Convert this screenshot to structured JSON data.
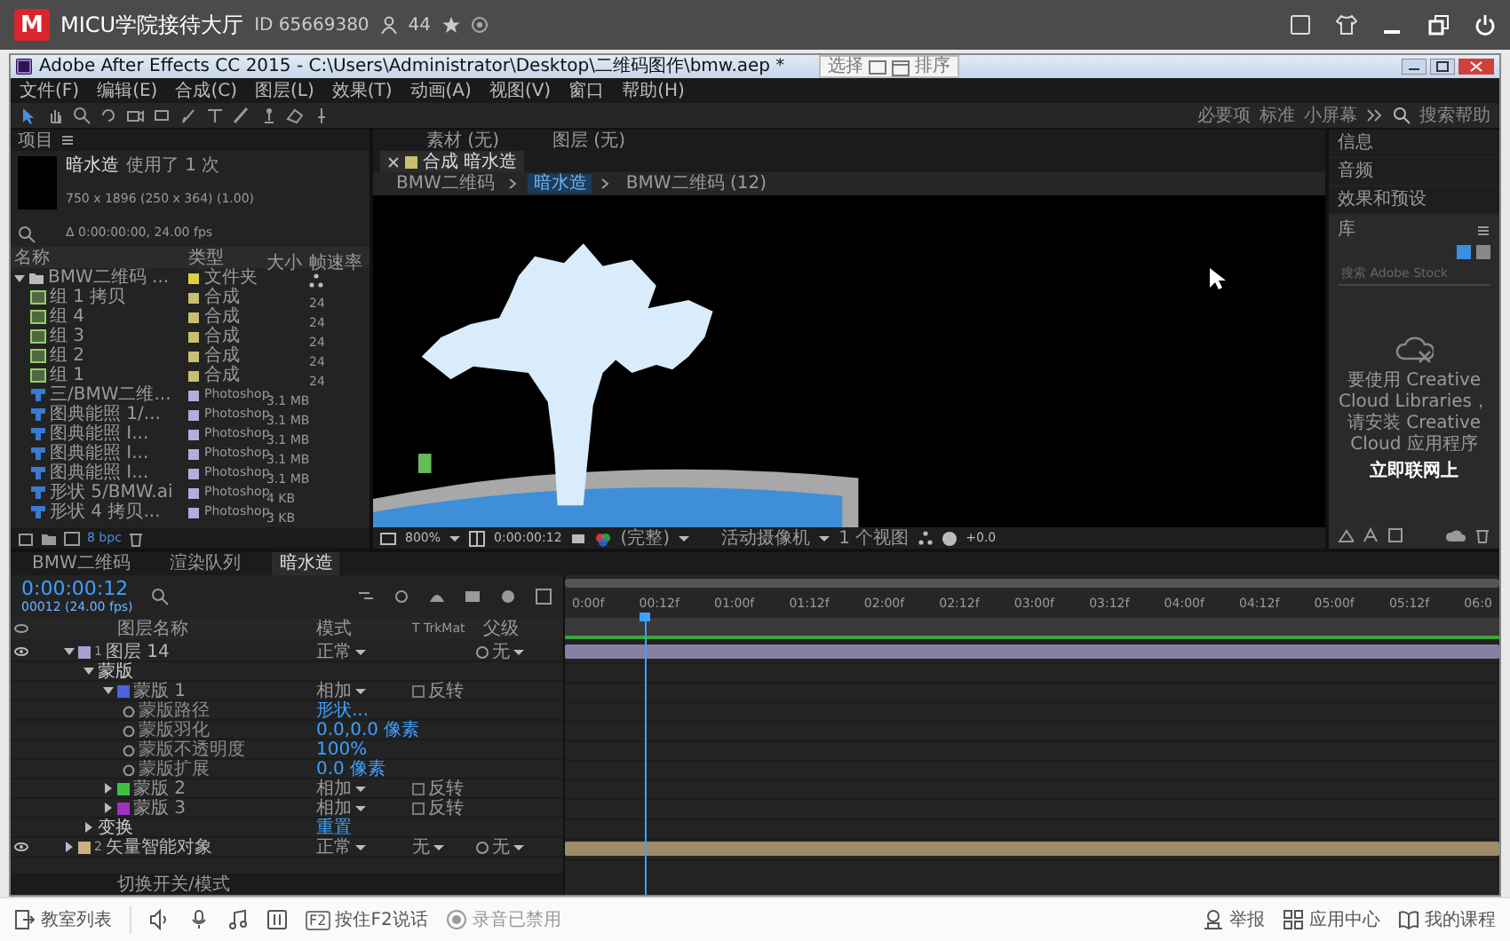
{
  "app_bar": {
    "logo": "M",
    "title": "MICU学院接待大厅",
    "room_id": "ID 65669380",
    "user_count": "44"
  },
  "ae_window": {
    "title": "Adobe After Effects CC 2015 - C:\\Users\\Administrator\\Desktop\\二维码图作\\bmw.aep *",
    "overlay_labels": [
      "选择",
      "排序"
    ],
    "menus": [
      "文件(F)",
      "编辑(E)",
      "合成(C)",
      "图层(L)",
      "效果(T)",
      "动画(A)",
      "视图(V)",
      "窗口",
      "帮助(H)"
    ],
    "workspaces": [
      "必要项",
      "标准",
      "小屏幕"
    ],
    "help_search": "搜索帮助"
  },
  "project": {
    "tab": "项目",
    "selection_name": "暗水造",
    "usage": "使用了 1 次",
    "size": "750 x 1896 (250 x 364) (1.00)",
    "duration": "Δ 0:00:00:00, 24.00 fps",
    "columns": [
      "名称",
      "类型",
      "大小",
      "帧速率"
    ],
    "bpc": "8 bpc",
    "items": [
      {
        "name": "BMW二维码 ...",
        "kind": "folder",
        "color": "#e0d040",
        "type": "文件夹",
        "expanded": true,
        "children": [
          {
            "name": "组 1 拷贝",
            "kind": "comp",
            "color": "#c8c070",
            "type": "合成",
            "rate": "24"
          },
          {
            "name": "组 4",
            "kind": "comp",
            "color": "#c8c070",
            "type": "合成",
            "rate": "24"
          },
          {
            "name": "组 3",
            "kind": "comp",
            "color": "#c8c070",
            "type": "合成",
            "rate": "24"
          },
          {
            "name": "组 2",
            "kind": "comp",
            "color": "#c8c070",
            "type": "合成",
            "rate": "24"
          },
          {
            "name": "组 1",
            "kind": "comp",
            "color": "#c8c070",
            "type": "合成",
            "rate": "24"
          },
          {
            "name": "三/BMW二维...",
            "kind": "footage",
            "color": "#b4acdc",
            "type": "Photoshop",
            "size": "3.1 MB"
          },
          {
            "name": "图典能照 1/...",
            "kind": "footage",
            "color": "#b4acdc",
            "type": "Photoshop",
            "size": "3.1 MB"
          },
          {
            "name": "图典能照 I...",
            "kind": "footage",
            "color": "#b4acdc",
            "type": "Photoshop",
            "size": "3.1 MB"
          },
          {
            "name": "图典能照 I...",
            "kind": "footage",
            "color": "#b4acdc",
            "type": "Photoshop",
            "size": "3.1 MB"
          },
          {
            "name": "图典能照 I...",
            "kind": "footage",
            "color": "#b4acdc",
            "type": "Photoshop",
            "size": "3.1 MB"
          },
          {
            "name": "形状 5/BMW.ai",
            "kind": "footage",
            "color": "#b4acdc",
            "type": "Photoshop",
            "size": "4 KB"
          },
          {
            "name": "形状 4 拷贝...",
            "kind": "footage",
            "color": "#b4acdc",
            "type": "Photoshop",
            "size": "3 KB"
          }
        ]
      }
    ]
  },
  "composition": {
    "source_tabs": [
      "素材 (无)",
      "图层 (无)"
    ],
    "header_tab": "合成 暗水造",
    "breadcrumbs": [
      {
        "label": "BMW二维码",
        "selected": false
      },
      {
        "label": "暗水造",
        "selected": true
      },
      {
        "label": "BMW二维码 (12)",
        "selected": false
      }
    ],
    "zoom": "800%",
    "timecode": "0:00:00:12",
    "resolution": "(完整)",
    "camera": "活动摄像机",
    "views": "1 个视图",
    "exposure": "+0.0"
  },
  "side_panel": {
    "sections": [
      "信息",
      "音频",
      "效果和预设"
    ],
    "library_title": "库",
    "library_search": "搜索 Adobe Stock",
    "message": "要使用 Creative Cloud Libraries，请安装 Creative Cloud 应用程序",
    "link": "立即联网上"
  },
  "timeline": {
    "tabs": [
      {
        "label": "BMW二维码",
        "selected": false
      },
      {
        "label": "渲染队列",
        "selected": false
      },
      {
        "label": "暗水造",
        "selected": true
      }
    ],
    "timecode": "0:00:00:12",
    "frame_info": "00012 (24.00 fps)",
    "columns": [
      "图层名称",
      "模式",
      "T TrkMat",
      "父级"
    ],
    "ticks": [
      "0:00f",
      "00:12f",
      "01:00f",
      "01:12f",
      "02:00f",
      "02:12f",
      "03:00f",
      "03:12f",
      "04:00f",
      "04:12f",
      "05:00f",
      "05:12f",
      "06:0"
    ],
    "playhead": {
      "level": 0.085
    },
    "footer": "切换开关/模式",
    "layers": [
      {
        "kind": "layer",
        "number": "1",
        "name": "图层 14",
        "color": "#a8a0d0",
        "visible": true,
        "mode": "正常",
        "parent": "无",
        "expanded": true,
        "children": [
          {
            "kind": "group",
            "name": "蒙版",
            "expanded": true,
            "children": [
              {
                "kind": "mask",
                "name": "蒙版 1",
                "color": "#5060e0",
                "mode": "相加",
                "inverted": false,
                "inverted_label": "反转",
                "expanded": true,
                "children": [
                  {
                    "kind": "property",
                    "name": "蒙版路径",
                    "value": "形状..."
                  },
                  {
                    "kind": "property",
                    "name": "蒙版羽化",
                    "value": "0.0,0.0 像素"
                  },
                  {
                    "kind": "property",
                    "name": "蒙版不透明度",
                    "value": "100%"
                  },
                  {
                    "kind": "property",
                    "name": "蒙版扩展",
                    "value": "0.0 像素"
                  }
                ]
              },
              {
                "kind": "mask",
                "name": "蒙版 2",
                "color": "#40c040",
                "mode": "相加",
                "inverted": false,
                "inverted_label": "反转",
                "expanded": false
              },
              {
                "kind": "mask",
                "name": "蒙版 3",
                "color": "#a030c0",
                "mode": "相加",
                "inverted": false,
                "inverted_label": "反转",
                "expanded": false
              }
            ]
          },
          {
            "kind": "group",
            "name": "变换",
            "value": "重置",
            "expanded": false
          }
        ]
      },
      {
        "kind": "layer",
        "number": "2",
        "name": "矢量智能对象",
        "color": "#c8b080",
        "visible": true,
        "mode": "正常",
        "trkmat": "无",
        "parent": "无",
        "expanded": false
      }
    ]
  },
  "bottom_bar": {
    "left": [
      {
        "kind": "exit",
        "label": "教室列表"
      }
    ],
    "talk_key": "F2",
    "talk": "按住F2说话",
    "record": "录音已禁用",
    "right": [
      {
        "kind": "report",
        "label": "举报"
      },
      {
        "kind": "apps",
        "label": "应用中心"
      },
      {
        "kind": "book",
        "label": "我的课程"
      }
    ]
  }
}
